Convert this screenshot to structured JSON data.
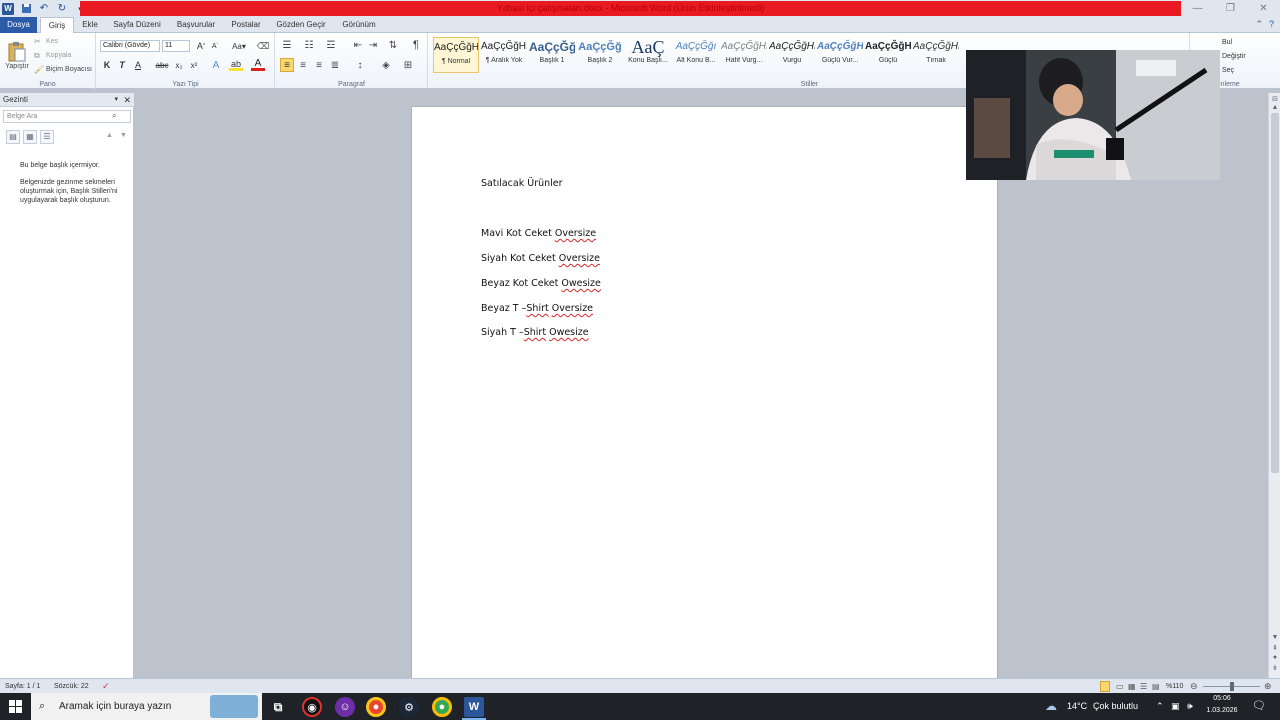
{
  "window": {
    "title": "Yılbası içi çalışmaları.docx - Microsoft Word (Ürün Etkinleştirilmedi)",
    "accent": "#ea1a23"
  },
  "quick_access": {
    "icons": [
      "word-app-icon",
      "save-icon",
      "undo-icon",
      "redo-icon",
      "customize-icon"
    ]
  },
  "tabs": {
    "file": "Dosya",
    "home": "Giriş",
    "insert": "Ekle",
    "layout": "Sayfa Düzeni",
    "references": "Başvurular",
    "mailings": "Postalar",
    "review": "Gözden Geçir",
    "view": "Görünüm"
  },
  "ribbon": {
    "clipboard": {
      "paste": "Yapıştır",
      "cut": "Kes",
      "copy": "Kopyala",
      "format_painter": "Biçim Boyacısı",
      "label": "Pano"
    },
    "font": {
      "name": "Calibri (Gövde)",
      "size": "11",
      "label": "Yazı Tipi",
      "bold": "K",
      "italic": "T",
      "underline": "A"
    },
    "paragraph": {
      "label": "Paragraf",
      "show_marks": "¶"
    },
    "styles": {
      "label": "Stiller",
      "items": [
        {
          "sample": "AaÇçĞğHı",
          "name": "¶ Normal"
        },
        {
          "sample": "AaÇçĞğHı",
          "name": "¶ Aralık Yok"
        },
        {
          "sample": "AaÇçĞğ",
          "name": "Başlık 1"
        },
        {
          "sample": "AaÇçĞğ",
          "name": "Başlık 2"
        },
        {
          "sample": "AaÇ",
          "name": "Konu Başlı..."
        },
        {
          "sample": "AaÇçĞğı",
          "name": "Alt Konu B..."
        },
        {
          "sample": "AaÇçĞğHı",
          "name": "Hafif Vurg..."
        },
        {
          "sample": "AaÇçĞğHı",
          "name": "Vurgu"
        },
        {
          "sample": "AaÇçĞğH",
          "name": "Güçlü Vur..."
        },
        {
          "sample": "AaÇçĞğHI",
          "name": "Güçlü"
        },
        {
          "sample": "AaÇçĞğHı",
          "name": "Tırnak"
        }
      ]
    },
    "editing": {
      "find": "Bul",
      "replace": "Değiştir",
      "select": "Seç",
      "label": "Düzenleme"
    }
  },
  "nav_pane": {
    "title": "Gezinti",
    "search_placeholder": "Belge Ara",
    "message1": "Bu belge başlık içermiyor.",
    "message2": "Belgenizde gezinme sekmeleri oluşturmak için, Başlık Stilleri'ni uygulayarak başlık oluşturun."
  },
  "document": {
    "title": "Satılacak Ürünler",
    "items": [
      {
        "text": "Mavi Kot Ceket ",
        "flag": "Oversize"
      },
      {
        "text": "Siyah Kot Ceket ",
        "flag": "Oversize"
      },
      {
        "text": "Beyaz Kot Ceket ",
        "flag": "Owesize"
      },
      {
        "text": "Beyaz T –",
        "flag": "Shirt",
        "text2": " ",
        "flag2": "Oversize"
      },
      {
        "text": "Siyah T –",
        "flag": "Shirt",
        "text2": " ",
        "flag2": "Owesize"
      }
    ]
  },
  "statusbar": {
    "page": "Sayfa: 1 / 1",
    "words": "Sözcük: 22",
    "zoom": "%110"
  },
  "taskbar": {
    "search_placeholder": "Aramak için buraya yazın",
    "weather_temp": "14°C",
    "weather_text": "Çok bulutlu",
    "time": "05:06",
    "date": "1.03.2026"
  }
}
